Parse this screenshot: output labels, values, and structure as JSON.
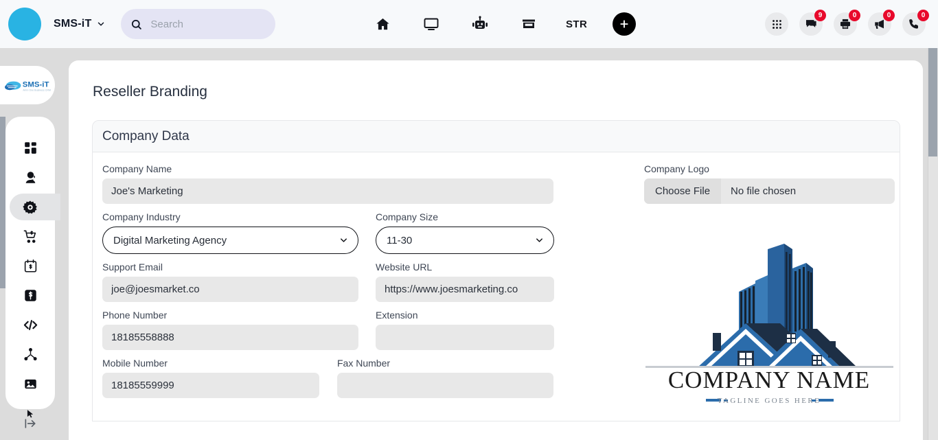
{
  "topbar": {
    "brand_name": "SMS-iT",
    "brand_caret_icon": "chevron-down-icon",
    "search": {
      "icon": "search-icon",
      "value": "",
      "placeholder": "Search"
    },
    "center_nav": [
      {
        "icon": "home-icon",
        "label": "Home"
      },
      {
        "icon": "monitor-icon",
        "label": "Display"
      },
      {
        "icon": "robot-icon",
        "label": "Bot"
      },
      {
        "icon": "store-icon",
        "label": "Store"
      }
    ],
    "str_label": "STR",
    "add_button": {
      "icon": "plus-icon",
      "label": "+"
    },
    "right_nav": [
      {
        "icon": "apps-grid-icon",
        "badge": null
      },
      {
        "icon": "chat-icon",
        "badge": "9"
      },
      {
        "icon": "printer-icon",
        "badge": "0"
      },
      {
        "icon": "megaphone-icon",
        "badge": "0"
      },
      {
        "icon": "phone-icon",
        "badge": "0"
      }
    ]
  },
  "sidebar": {
    "logo_text": "SMS-iT",
    "items": [
      {
        "icon": "dashboard-grid-icon",
        "name": "dashboard",
        "active": false
      },
      {
        "icon": "contact-agent-icon",
        "name": "contacts",
        "active": false
      },
      {
        "icon": "gear-icon",
        "name": "settings",
        "active": true
      },
      {
        "icon": "cart-dollar-icon",
        "name": "ecommerce",
        "active": false
      },
      {
        "icon": "calendar-dollar-icon",
        "name": "billing",
        "active": false
      },
      {
        "icon": "dollar-box-icon",
        "name": "payments",
        "active": false
      },
      {
        "icon": "code-icon",
        "name": "developer",
        "active": false
      },
      {
        "icon": "network-nodes-icon",
        "name": "integrations",
        "active": false
      },
      {
        "icon": "image-icon",
        "name": "media",
        "active": false
      }
    ],
    "collapse_icon": "expand-arrow-icon"
  },
  "main": {
    "page_title": "Reseller Branding",
    "card_title": "Company Data",
    "fields": {
      "company_name": {
        "label": "Company Name",
        "value": "Joe's Marketing",
        "placeholder": ""
      },
      "company_industry": {
        "label": "Company Industry",
        "value": "Digital Marketing Agency",
        "caret": "chevron-down-icon"
      },
      "company_size": {
        "label": "Company Size",
        "value": "11-30",
        "caret": "chevron-down-icon"
      },
      "support_email": {
        "label": "Support Email",
        "value": "joe@joesmarket.co",
        "placeholder": ""
      },
      "website_url": {
        "label": "Website URL",
        "value": "https://www.joesmarketing.co",
        "placeholder": ""
      },
      "phone_number": {
        "label": "Phone Number",
        "value": "18185558888",
        "placeholder": ""
      },
      "extension": {
        "label": "Extension",
        "value": "",
        "placeholder": ""
      },
      "mobile_number": {
        "label": "Mobile Number",
        "value": "18185559999",
        "placeholder": ""
      },
      "fax_number": {
        "label": "Fax Number",
        "value": "",
        "placeholder": ""
      }
    },
    "logo": {
      "label": "Company Logo",
      "choose_file_label": "Choose File",
      "no_file_label": "No file chosen",
      "preview_company_name": "COMPANY NAME",
      "preview_tagline": "TAGLINE GOES HERE"
    }
  },
  "colors": {
    "brand_cyan": "#29b3e3",
    "badge_red": "#e8092b",
    "search_bg": "#e4e4f4",
    "input_bg": "#e8e8e8",
    "logo_blue": "#2b6cab",
    "logo_dark": "#1d2f45",
    "page_bg": "#dcdcdc"
  }
}
